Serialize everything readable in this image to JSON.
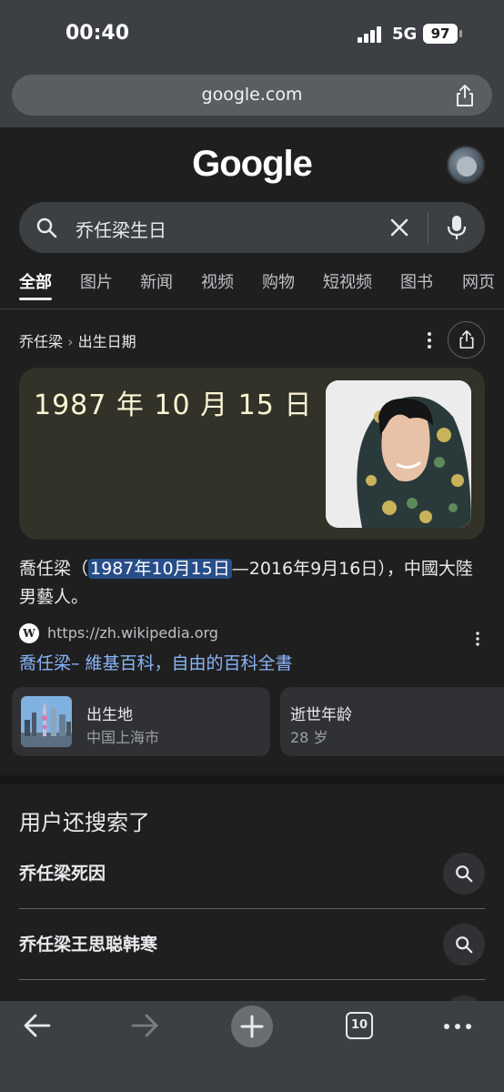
{
  "status_bar": {
    "time": "00:40",
    "network": "5G",
    "battery": "97"
  },
  "browser": {
    "url": "google.com"
  },
  "google": {
    "logo": "Google"
  },
  "search": {
    "query": "乔任梁生日"
  },
  "tabs": [
    "全部",
    "图片",
    "新闻",
    "视频",
    "购物",
    "短视频",
    "图书",
    "网页"
  ],
  "answer": {
    "entity": "乔任梁",
    "separator": "›",
    "attribute": "出生日期",
    "date": "1987 年 10 月 15 日"
  },
  "snippet": {
    "pre": "喬任梁（",
    "highlight": "1987年10月15日",
    "post": "—2016年9月16日），中國大陸男藝人。"
  },
  "source": {
    "favicon": "W",
    "url": "https://zh.wikipedia.org",
    "title": "喬任梁– 維基百科，自由的百科全書"
  },
  "chips": [
    {
      "title": "出生地",
      "value": "中国上海市"
    },
    {
      "title": "逝世年龄",
      "value": "28 岁"
    }
  ],
  "related": {
    "heading": "用户还搜索了",
    "items": [
      "乔任梁死因",
      "乔任梁王思聪韩寒"
    ]
  },
  "toolbar": {
    "tab_count": "10"
  }
}
